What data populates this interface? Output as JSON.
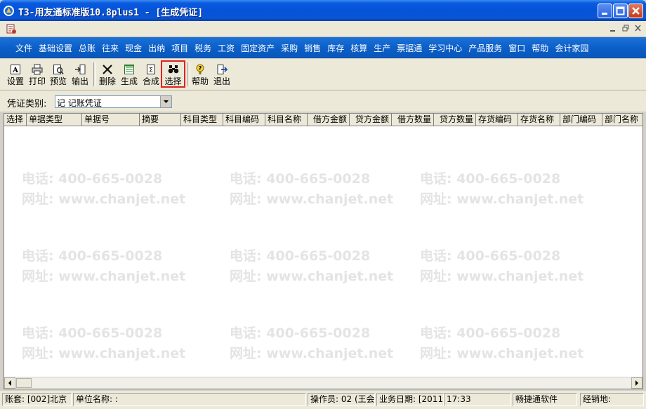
{
  "window": {
    "title": "T3-用友通标准版10.8plus1 - [生成凭证]"
  },
  "menu": [
    "文件",
    "基础设置",
    "总账",
    "往来",
    "现金",
    "出纳",
    "项目",
    "税务",
    "工资",
    "固定资产",
    "采购",
    "销售",
    "库存",
    "核算",
    "生产",
    "票据通",
    "学习中心",
    "产品服务",
    "窗口",
    "帮助",
    "会计家园"
  ],
  "toolbar": {
    "buttons": [
      {
        "label": "设置",
        "icon": "settings-icon"
      },
      {
        "label": "打印",
        "icon": "print-icon"
      },
      {
        "label": "预览",
        "icon": "preview-icon"
      },
      {
        "label": "输出",
        "icon": "export-icon"
      },
      {
        "label": "删除",
        "icon": "delete-icon"
      },
      {
        "label": "生成",
        "icon": "generate-icon"
      },
      {
        "label": "合成",
        "icon": "merge-icon"
      },
      {
        "label": "选择",
        "icon": "binoculars-icon"
      },
      {
        "label": "帮助",
        "icon": "help-icon"
      },
      {
        "label": "退出",
        "icon": "exit-icon"
      }
    ],
    "selected": "选择",
    "highlight_color": "#e02020"
  },
  "filter": {
    "label": "凭证类别:",
    "voucher_type_value": "记 记账凭证"
  },
  "grid": {
    "columns": [
      "选择",
      "单据类型",
      "单据号",
      "摘要",
      "科目类型",
      "科目编码",
      "科目名称",
      "借方金额",
      "贷方金额",
      "借方数量",
      "贷方数量",
      "存货编码",
      "存货名称",
      "部门编码",
      "部门名称"
    ],
    "rows": []
  },
  "watermark": {
    "phone": "电话: 400-665-0028",
    "website": "网址: www.chanjet.net"
  },
  "status": {
    "account": "账套: [002]北京",
    "company": "单位名称: :",
    "operator": "操作员: 02 (王会",
    "business_date": "业务日期: [2011",
    "time": "17:33",
    "vendor": "畅捷通软件",
    "dealer": "经销地:"
  },
  "colors": {
    "titlebar": "#0453d8",
    "menubar": "#0b5fc9",
    "chrome": "#ece9d8"
  }
}
